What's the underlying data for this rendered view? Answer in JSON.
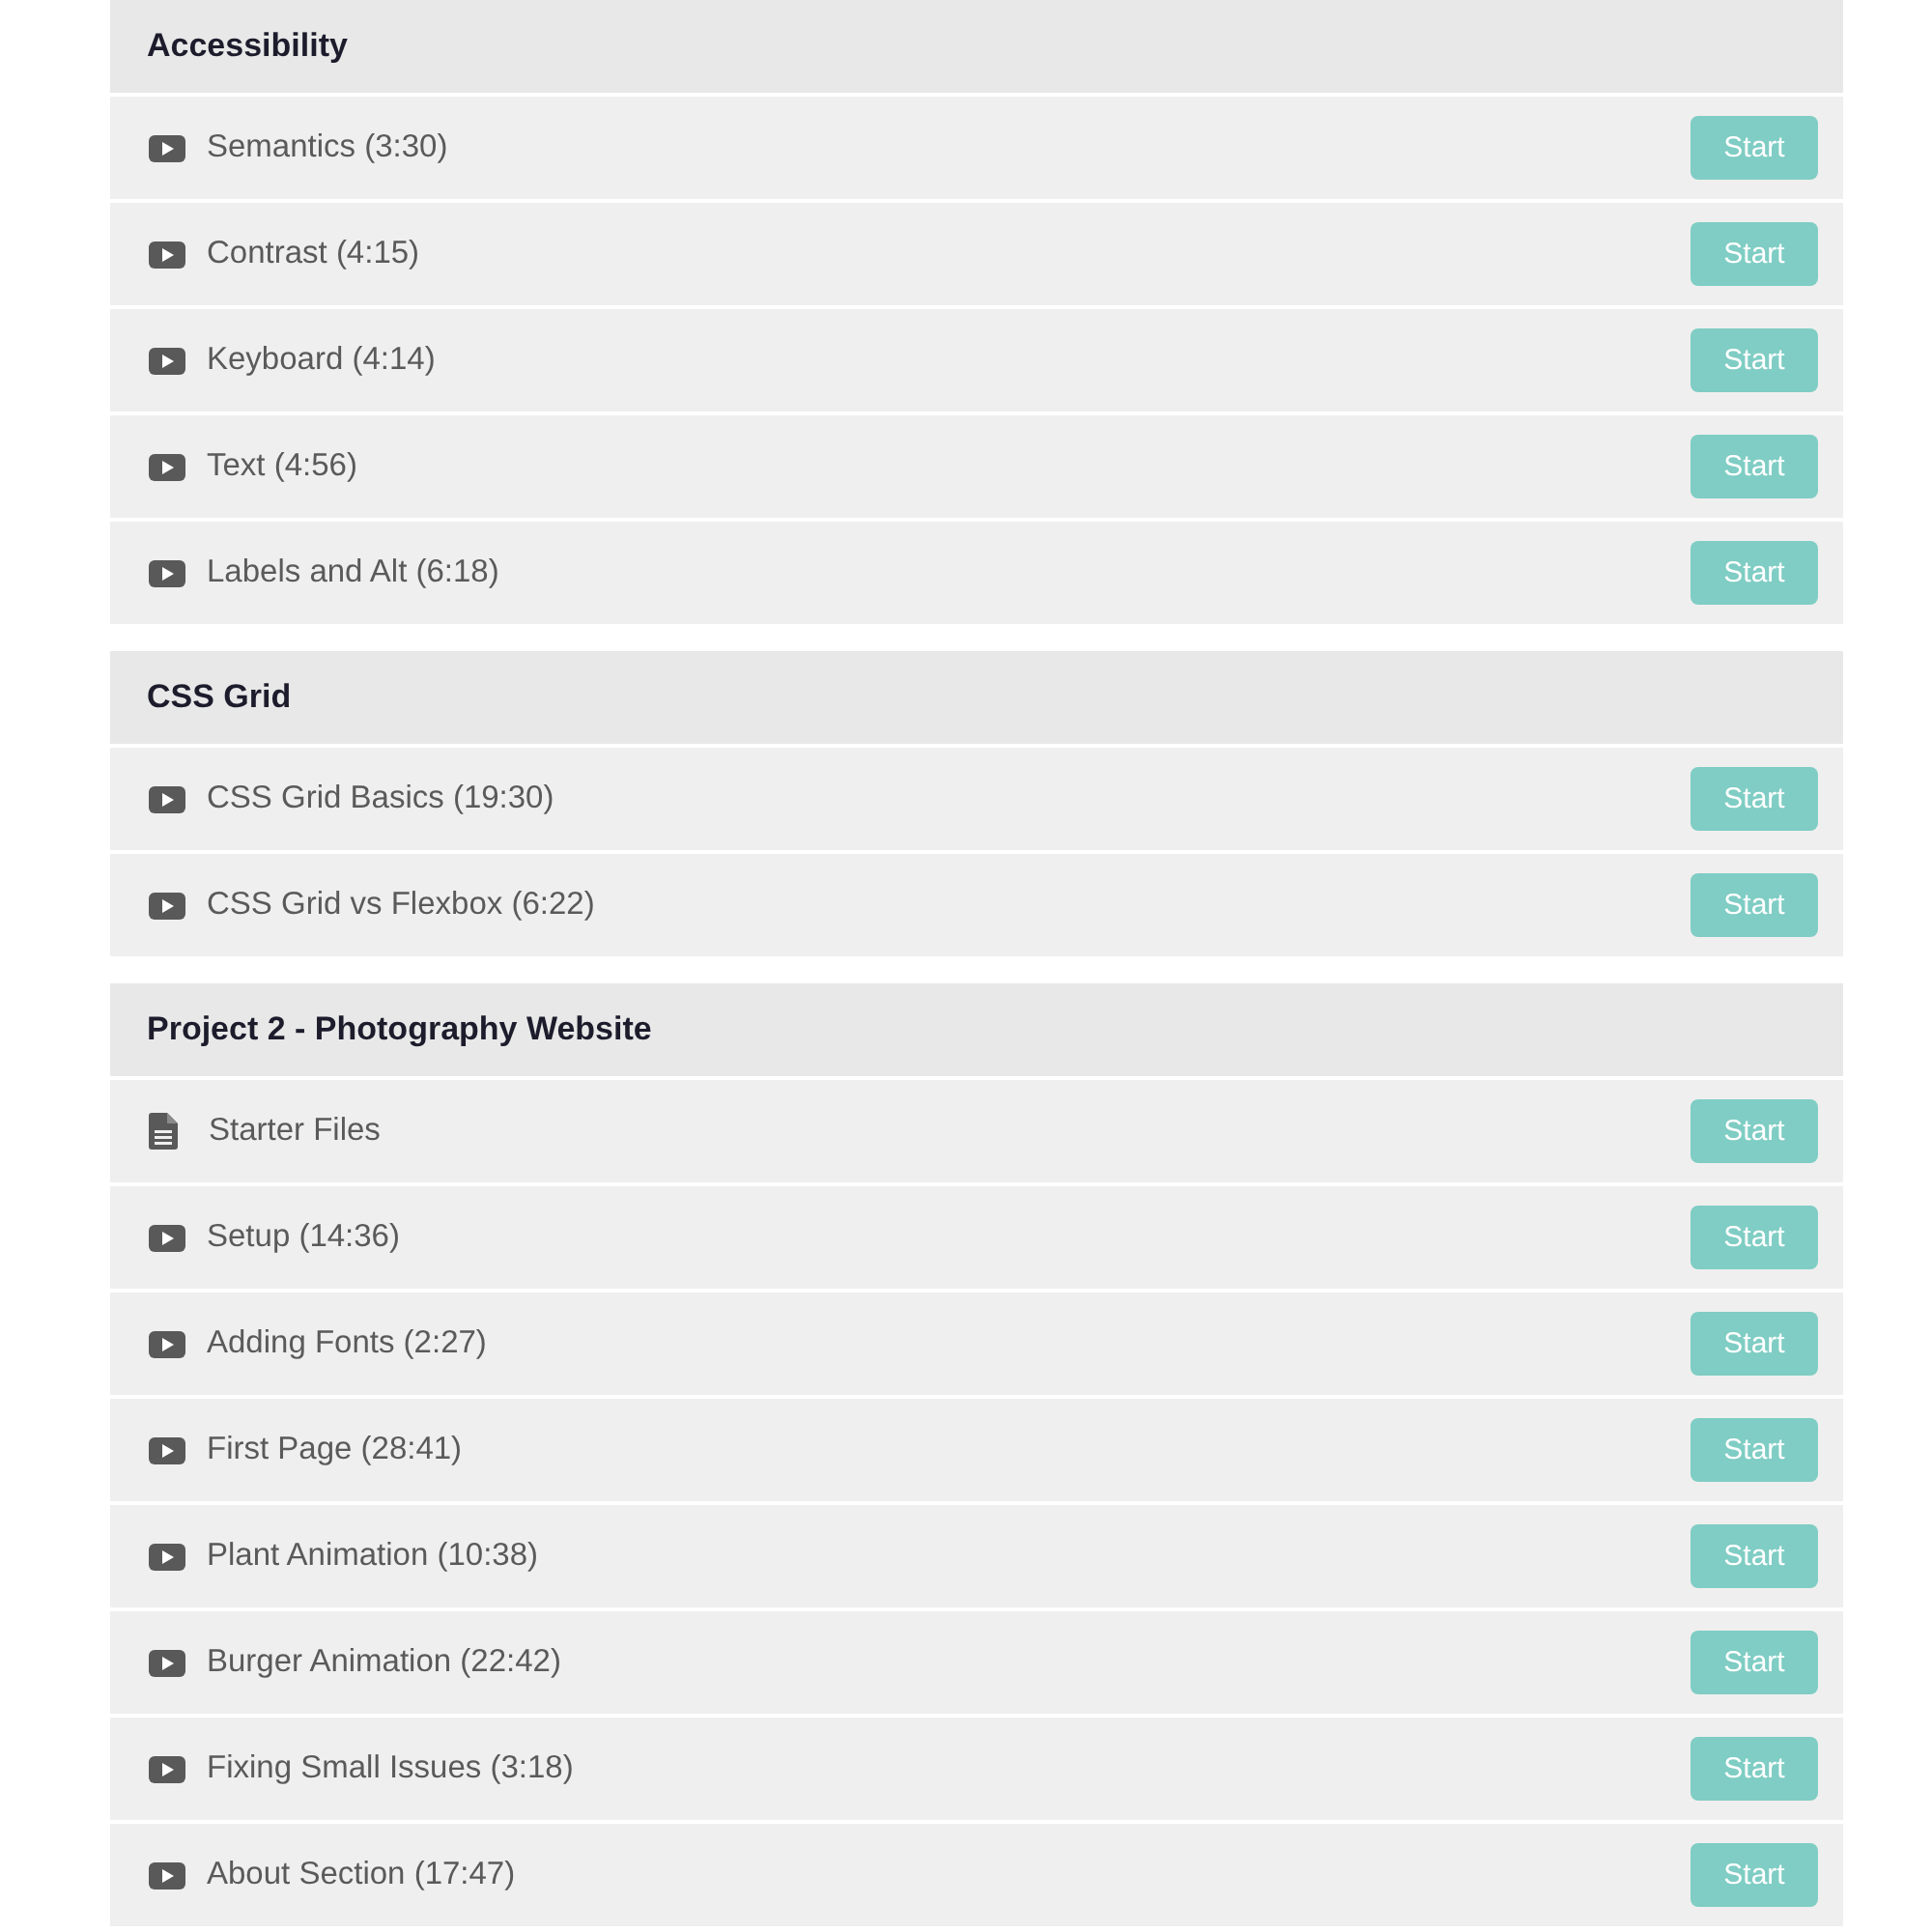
{
  "sections": [
    {
      "title": "Accessibility",
      "lessons": [
        {
          "kind": "video",
          "title": "Semantics (3:30)",
          "action": "Start"
        },
        {
          "kind": "video",
          "title": "Contrast (4:15)",
          "action": "Start"
        },
        {
          "kind": "video",
          "title": "Keyboard (4:14)",
          "action": "Start"
        },
        {
          "kind": "video",
          "title": "Text (4:56)",
          "action": "Start"
        },
        {
          "kind": "video",
          "title": "Labels and Alt (6:18)",
          "action": "Start"
        }
      ]
    },
    {
      "title": "CSS Grid",
      "lessons": [
        {
          "kind": "video",
          "title": "CSS Grid Basics (19:30)",
          "action": "Start"
        },
        {
          "kind": "video",
          "title": "CSS Grid vs Flexbox (6:22)",
          "action": "Start"
        }
      ]
    },
    {
      "title": "Project 2 - Photography Website",
      "lessons": [
        {
          "kind": "file",
          "title": "Starter Files",
          "action": "Start"
        },
        {
          "kind": "video",
          "title": "Setup (14:36)",
          "action": "Start"
        },
        {
          "kind": "video",
          "title": "Adding Fonts (2:27)",
          "action": "Start"
        },
        {
          "kind": "video",
          "title": "First Page (28:41)",
          "action": "Start"
        },
        {
          "kind": "video",
          "title": "Plant Animation (10:38)",
          "action": "Start"
        },
        {
          "kind": "video",
          "title": "Burger Animation (22:42)",
          "action": "Start"
        },
        {
          "kind": "video",
          "title": "Fixing Small Issues (3:18)",
          "action": "Start"
        },
        {
          "kind": "video",
          "title": "About Section (17:47)",
          "action": "Start"
        }
      ]
    }
  ]
}
